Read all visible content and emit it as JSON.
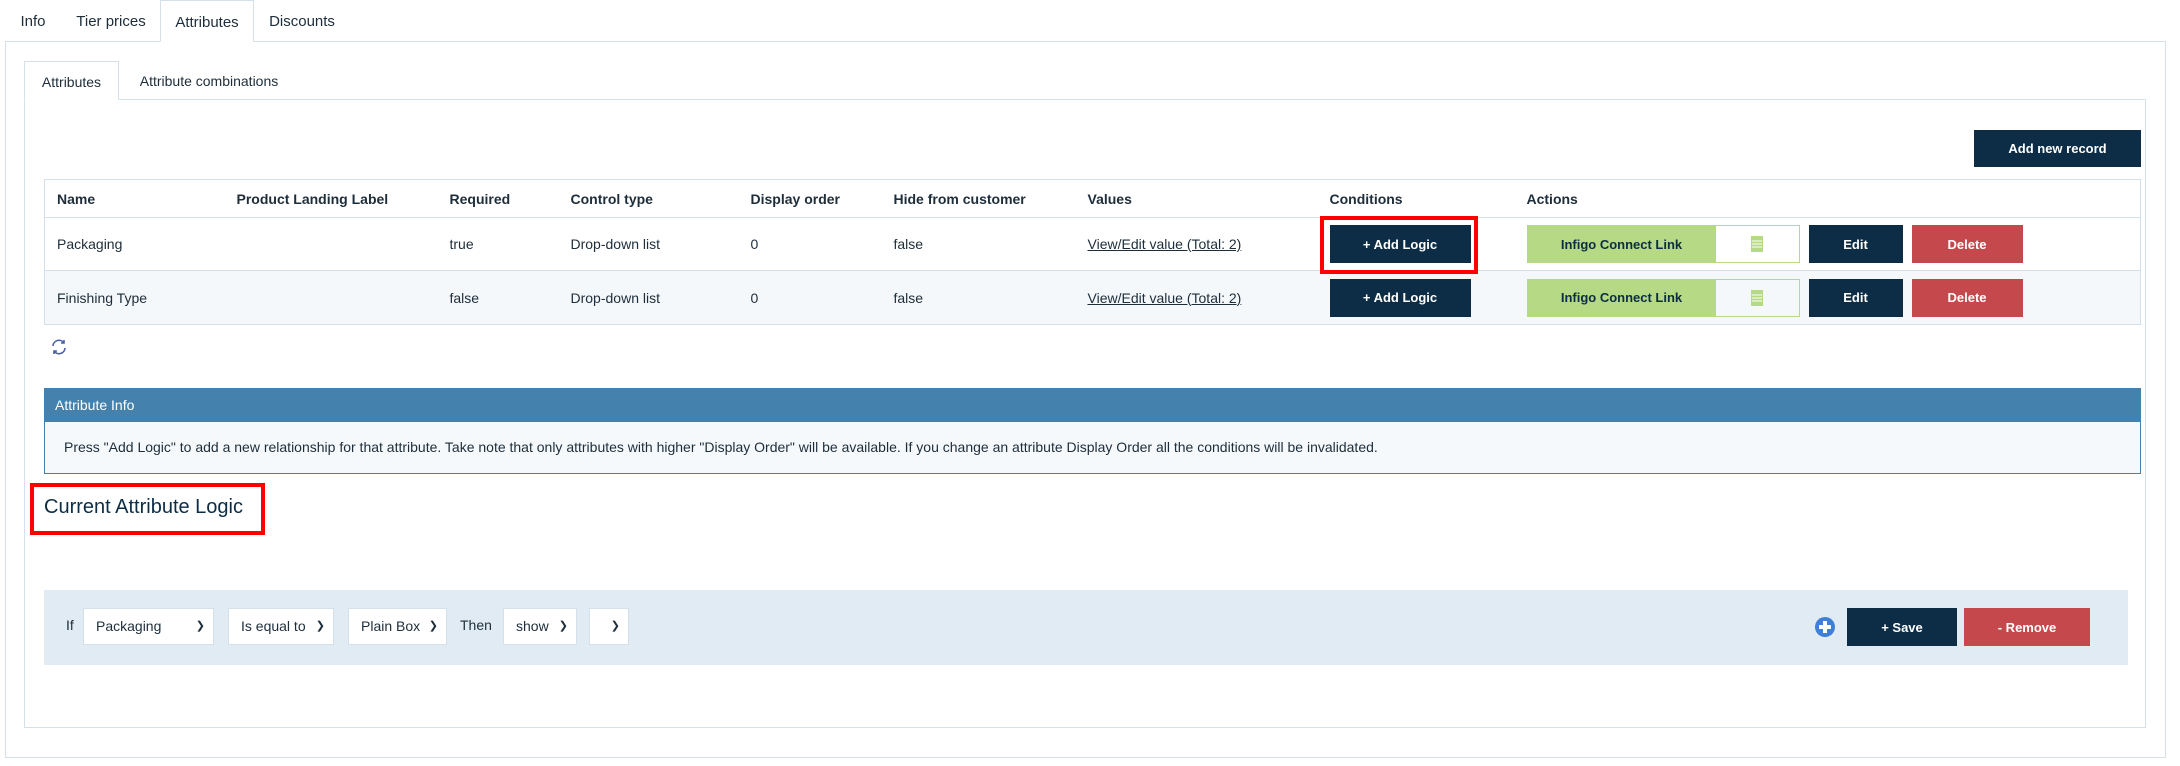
{
  "top_tabs": [
    {
      "label": "Info",
      "active": false
    },
    {
      "label": "Tier prices",
      "active": false
    },
    {
      "label": "Attributes",
      "active": true
    },
    {
      "label": "Discounts",
      "active": false
    }
  ],
  "inner_tabs": [
    {
      "label": "Attributes",
      "active": true
    },
    {
      "label": "Attribute combinations",
      "active": false
    }
  ],
  "add_new_record_label": "Add new record",
  "table": {
    "columns": [
      "Name",
      "Product Landing Label",
      "Required",
      "Control type",
      "Display order",
      "Hide from customer",
      "Values",
      "Conditions",
      "Actions"
    ],
    "rows": [
      {
        "name": "Packaging",
        "landing_label": "",
        "required": "true",
        "control_type": "Drop-down list",
        "display_order": "0",
        "hide": "false",
        "values": "View/Edit value (Total: 2)",
        "conditions": "+ Add Logic",
        "infigo": "Infigo Connect Link",
        "edit": "Edit",
        "delete": "Delete"
      },
      {
        "name": "Finishing Type",
        "landing_label": "",
        "required": "false",
        "control_type": "Drop-down list",
        "display_order": "0",
        "hide": "false",
        "values": "View/Edit value (Total: 2)",
        "conditions": "+ Add Logic",
        "infigo": "Infigo Connect Link",
        "edit": "Edit",
        "delete": "Delete"
      }
    ]
  },
  "info": {
    "title": "Attribute Info",
    "text": "Press \"Add Logic\" to add a new relationship for that attribute. Take note that only attributes with higher \"Display Order\" will be available. If you change an attribute Display Order all the conditions will be invalidated."
  },
  "logic": {
    "title": "Current Attribute Logic",
    "if_label": "If",
    "attribute": "Packaging",
    "operator": "Is equal to",
    "value": "Plain Box",
    "then_label": "Then",
    "action": "show",
    "target": "",
    "save_label": "+ Save",
    "remove_label": "- Remove"
  },
  "colors": {
    "navy": "#0c2d45",
    "red": "#c5494c",
    "green": "#b5d985",
    "info_header": "#4482ad",
    "highlight": "#ff0000"
  }
}
